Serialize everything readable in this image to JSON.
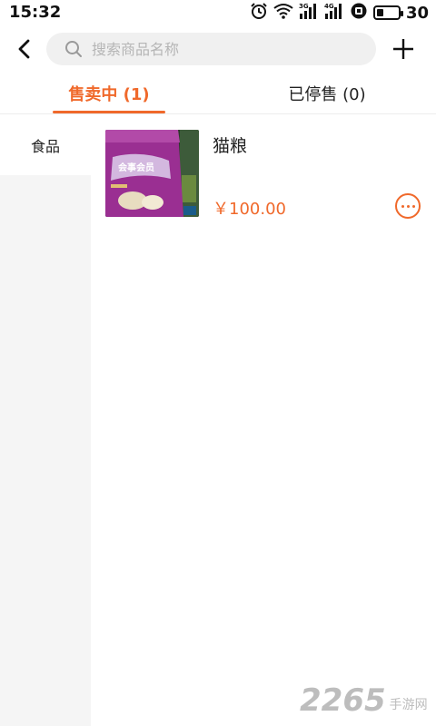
{
  "status_bar": {
    "time": "15:32",
    "battery_level": "30",
    "battery_fraction": 0.3,
    "icons": [
      "alarm-icon",
      "wifi-icon",
      "signal-3g-icon",
      "signal-4g-icon",
      "hd-icon",
      "battery-icon"
    ],
    "signal_label_1": "3G",
    "signal_label_2": "4G"
  },
  "header": {
    "search_placeholder": "搜索商品名称",
    "back_icon": "back-arrow-icon",
    "add_icon": "plus-icon"
  },
  "tabs": [
    {
      "label": "售卖中 (1)",
      "active": true
    },
    {
      "label": "已停售 (0)",
      "active": false
    }
  ],
  "sidebar": {
    "items": [
      {
        "label": "食品",
        "selected": true
      }
    ]
  },
  "products": [
    {
      "name": "猫粮",
      "price": "￥100.00",
      "image_text": "会事会员"
    }
  ],
  "watermark": {
    "number": "2265",
    "text": "手游网"
  },
  "colors": {
    "accent": "#f0692b",
    "background": "#ffffff",
    "sidebar_bg": "#f5f5f5",
    "search_bg": "#f0f0f0"
  }
}
